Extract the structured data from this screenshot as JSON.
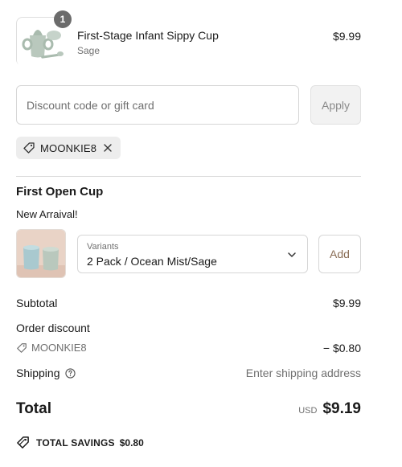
{
  "line_item": {
    "quantity": "1",
    "name": "First-Stage Infant Sippy Cup",
    "variant": "Sage",
    "price": "$9.99",
    "image_icon": "sippy-cup-set-image"
  },
  "discount": {
    "placeholder": "Discount code or gift card",
    "value": "",
    "apply_label": "Apply",
    "applied_code": "MOONKIE8"
  },
  "upsell": {
    "title": "First Open Cup",
    "subtitle": "New Arraival!",
    "variant_caption": "Variants",
    "variant_value": "2 Pack / Ocean Mist/Sage",
    "add_label": "Add",
    "image_icon": "open-cup-pair-image"
  },
  "summary": {
    "subtotal_label": "Subtotal",
    "subtotal_value": "$9.99",
    "order_discount_label": "Order discount",
    "discount_code": "MOONKIE8",
    "discount_value": "− $0.80",
    "shipping_label": "Shipping",
    "shipping_value": "Enter shipping address",
    "total_label": "Total",
    "currency": "USD",
    "total_value": "$9.19",
    "savings_label": "TOTAL SAVINGS",
    "savings_value": "$0.80"
  },
  "colors": {
    "badge": "#6b6b6b",
    "product_sage": "#b9c8bd",
    "add_text": "#8a6d55",
    "divider": "#dcdcdc"
  }
}
